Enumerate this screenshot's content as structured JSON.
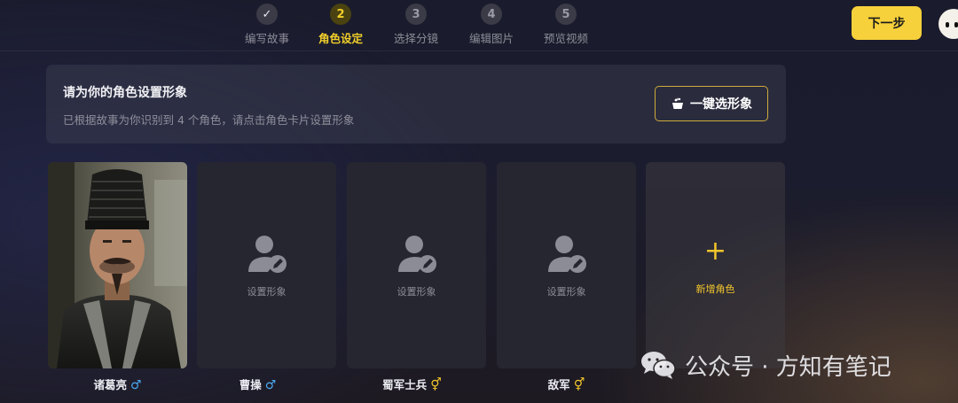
{
  "header": {
    "steps": [
      {
        "number": "✓",
        "label": "编写故事",
        "state": "done"
      },
      {
        "number": "2",
        "label": "角色设定",
        "state": "active"
      },
      {
        "number": "3",
        "label": "选择分镜",
        "state": "todo"
      },
      {
        "number": "4",
        "label": "编辑图片",
        "state": "todo"
      },
      {
        "number": "5",
        "label": "预览视频",
        "state": "todo"
      }
    ],
    "next_label": "下一步"
  },
  "banner": {
    "title": "请为你的角色设置形象",
    "subtitle": "已根据故事为你识别到 4 个角色，请点击角色卡片设置形象",
    "auto_button_label": "一键选形象"
  },
  "characters": [
    {
      "name": "诸葛亮",
      "gender_symbol": "♂",
      "gender": "male",
      "has_image": true,
      "placeholder": ""
    },
    {
      "name": "曹操",
      "gender_symbol": "♂",
      "gender": "male",
      "has_image": false,
      "placeholder": "设置形象"
    },
    {
      "name": "蜀军士兵",
      "gender_symbol": "⚥",
      "gender": "unspecified",
      "has_image": false,
      "placeholder": "设置形象"
    },
    {
      "name": "敌军",
      "gender_symbol": "⚥",
      "gender": "unspecified",
      "has_image": false,
      "placeholder": "设置形象"
    }
  ],
  "add_card": {
    "plus": "+",
    "label": "新增角色"
  },
  "watermark": {
    "text": "公众号 · 方知有笔记"
  },
  "colors": {
    "accent": "#f6d13b",
    "male": "#4aa8f0",
    "unspecified": "#f2c52c"
  }
}
